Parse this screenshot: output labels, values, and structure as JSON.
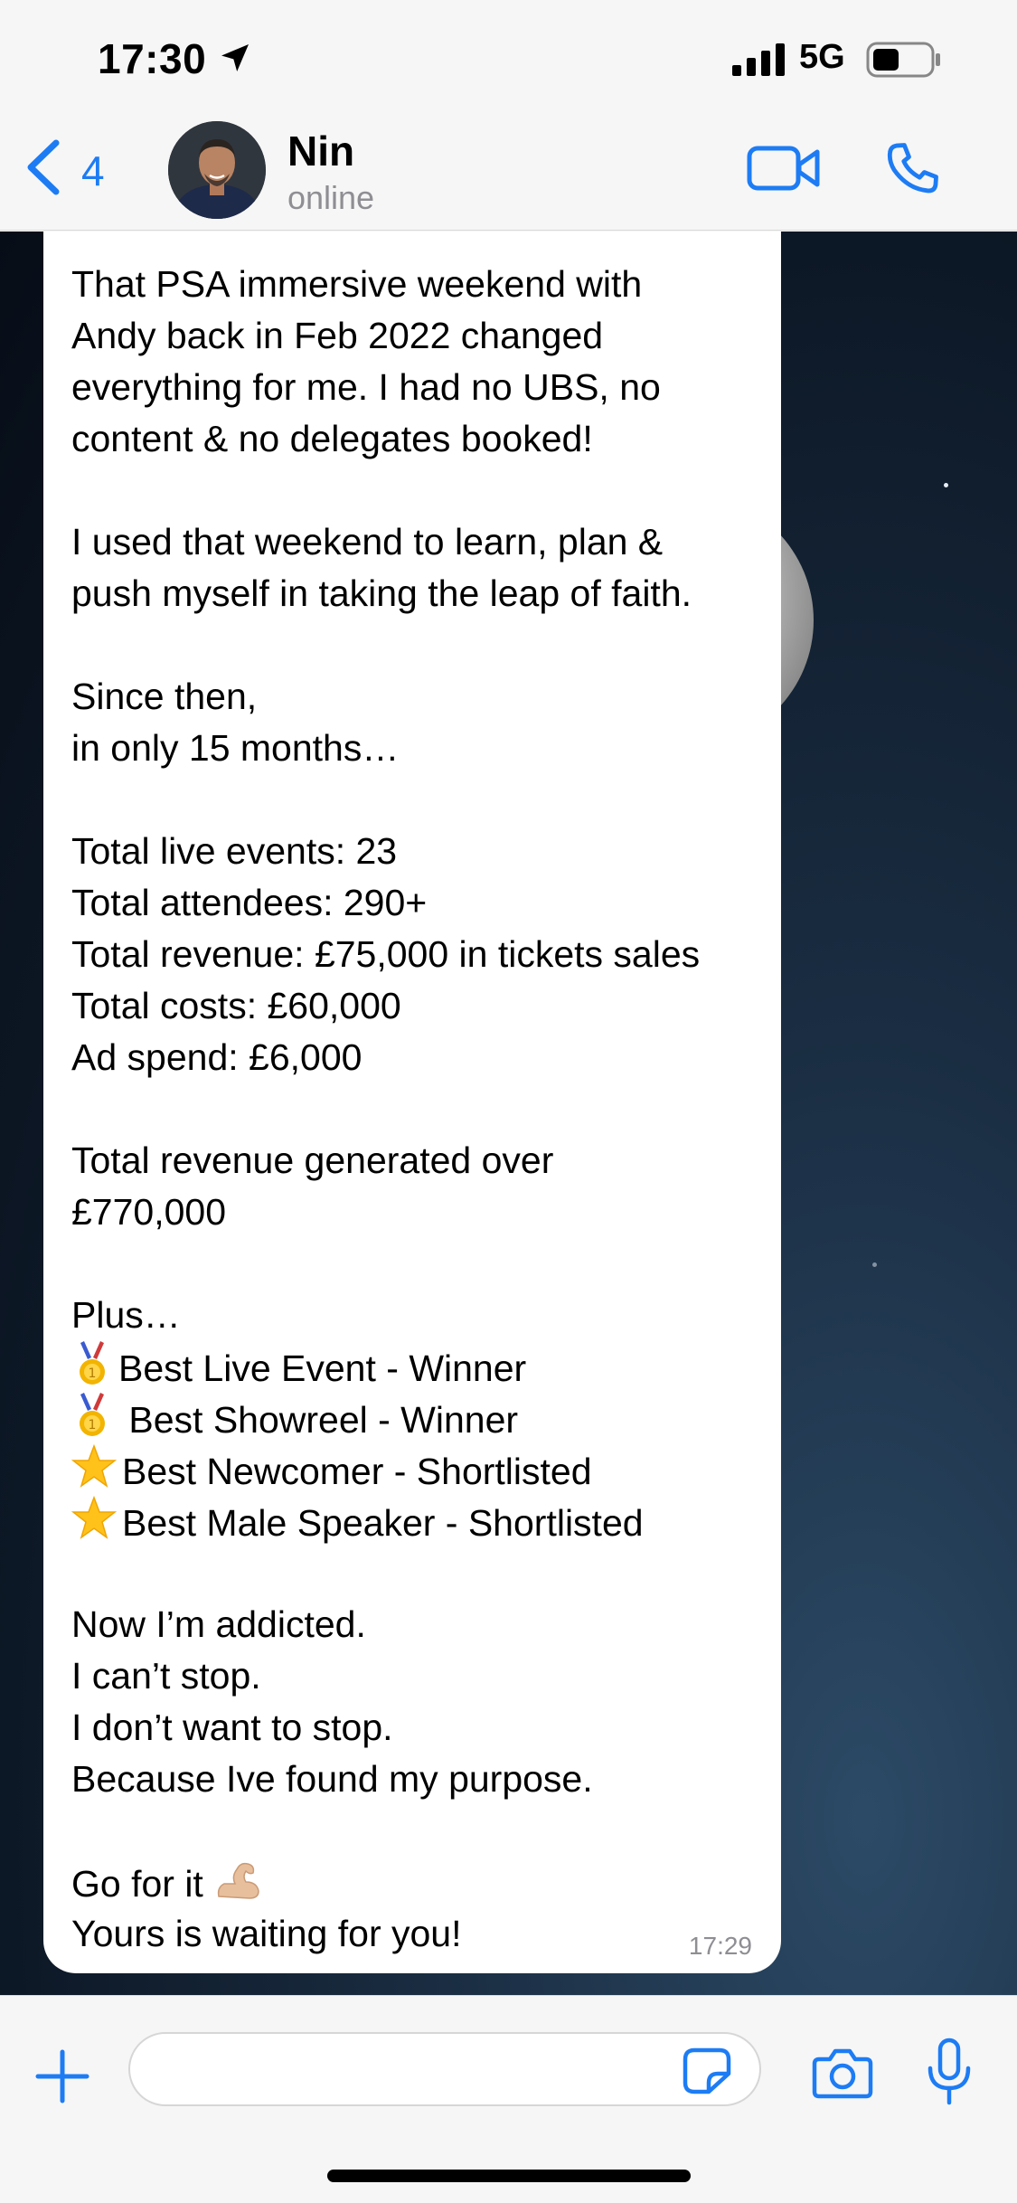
{
  "status_bar": {
    "time": "17:30",
    "network": "5G"
  },
  "header": {
    "back_count": "4",
    "contact_name": "Nin",
    "contact_status": "online"
  },
  "message": {
    "lines": [
      "That PSA immersive weekend with",
      "Andy back in Feb 2022 changed",
      "everything for me. I had no UBS, no",
      "content & no delegates booked!",
      "",
      "I used that weekend to learn, plan &",
      "push myself in taking the leap of faith.",
      "",
      "Since then,",
      "in only 15 months…",
      "",
      "Total live events: 23",
      "Total attendees: 290+",
      "Total revenue: £75,000 in tickets sales",
      "Total costs: £60,000",
      "Ad spend: £6,000",
      "",
      "Total revenue generated over",
      "£770,000",
      "",
      "Plus…"
    ],
    "awards": [
      {
        "icon": "medal",
        "text": "Best Live Event - Winner"
      },
      {
        "icon": "medal",
        "text": " Best Showreel - Winner"
      },
      {
        "icon": "star",
        "text": "Best Newcomer - Shortlisted"
      },
      {
        "icon": "star",
        "text": "Best Male Speaker - Shortlisted"
      }
    ],
    "closing_lines": [
      "",
      "Now I’m addicted.",
      "I can’t stop.",
      "I don’t want to stop.",
      "Because Ive found my purpose.",
      ""
    ],
    "go_for_it": "Go for it ",
    "final_line": "Yours is waiting for you!",
    "time": "17:29"
  },
  "colors": {
    "accent": "#1d7cf4",
    "bubble": "#ffffff",
    "bar_bg": "#f6f6f6"
  },
  "icons": {
    "back": "chevron-left-icon",
    "video": "video-camera-icon",
    "call": "phone-icon",
    "plus": "plus-icon",
    "sticker": "sticker-icon",
    "camera": "camera-icon",
    "mic": "microphone-icon"
  }
}
